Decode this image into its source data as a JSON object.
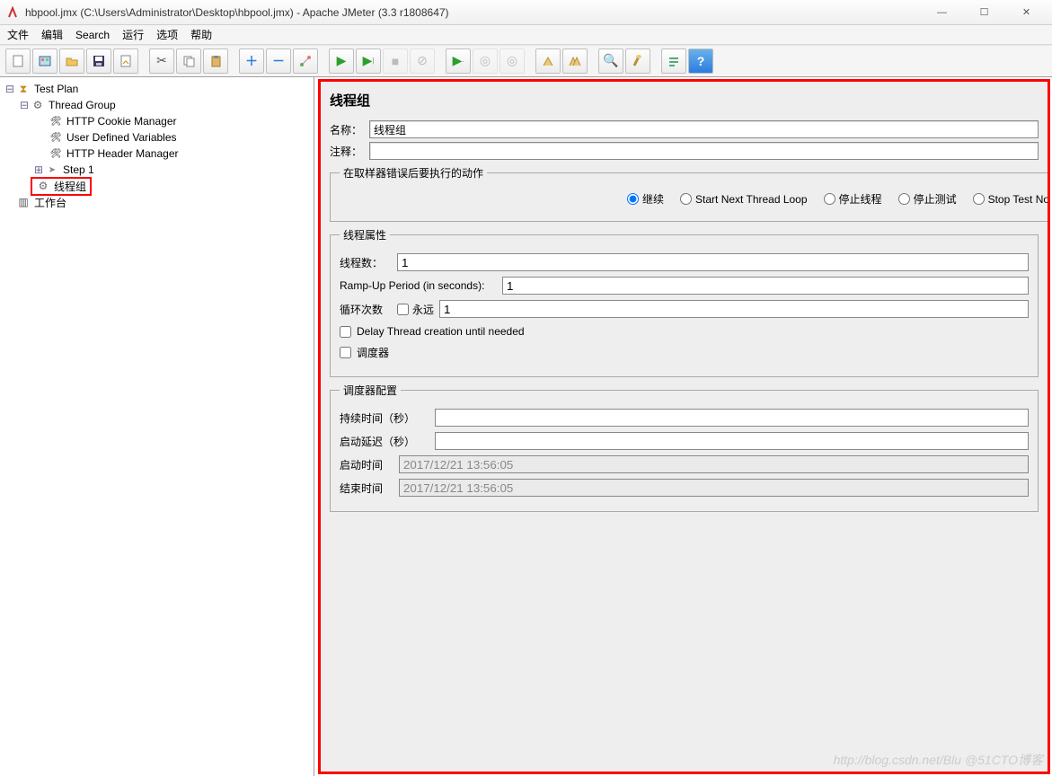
{
  "window": {
    "title": "hbpool.jmx (C:\\Users\\Administrator\\Desktop\\hbpool.jmx) - Apache JMeter (3.3 r1808647)"
  },
  "menu": [
    "文件",
    "编辑",
    "Search",
    "运行",
    "选项",
    "帮助"
  ],
  "tree": {
    "root": "Test Plan",
    "thread_group": "Thread Group",
    "cookie": "HTTP Cookie Manager",
    "vars": "User Defined Variables",
    "header": "HTTP Header Manager",
    "step1": "Step 1",
    "thread_cn": "线程组",
    "workbench": "工作台"
  },
  "panel": {
    "title": "线程组",
    "name_label": "名称：",
    "name_value": "线程组",
    "comment_label": "注释：",
    "comment_value": "",
    "error_group_title": "在取样器错误后要执行的动作",
    "radios": {
      "continue": "继续",
      "start_next": "Start Next Thread Loop",
      "stop_thread": "停止线程",
      "stop_test": "停止测试",
      "stop_test_now": "Stop Test No"
    },
    "props": {
      "title": "线程属性",
      "threads_label": "线程数：",
      "threads_value": "1",
      "ramp_label": "Ramp-Up Period (in seconds):",
      "ramp_value": "1",
      "loop_label": "循环次数",
      "forever_label": "永远",
      "loop_value": "1",
      "delay_label": "Delay Thread creation until needed",
      "scheduler_label": "调度器"
    },
    "sched": {
      "title": "调度器配置",
      "duration_label": "持续时间（秒）",
      "duration_value": "",
      "startup_delay_label": "启动延迟（秒）",
      "startup_delay_value": "",
      "start_time_label": "启动时间",
      "start_time_value": "2017/12/21 13:56:05",
      "end_time_label": "结束时间",
      "end_time_value": "2017/12/21 13:56:05"
    }
  },
  "watermark": "http://blog.csdn.net/Blu   @51CTO博客"
}
